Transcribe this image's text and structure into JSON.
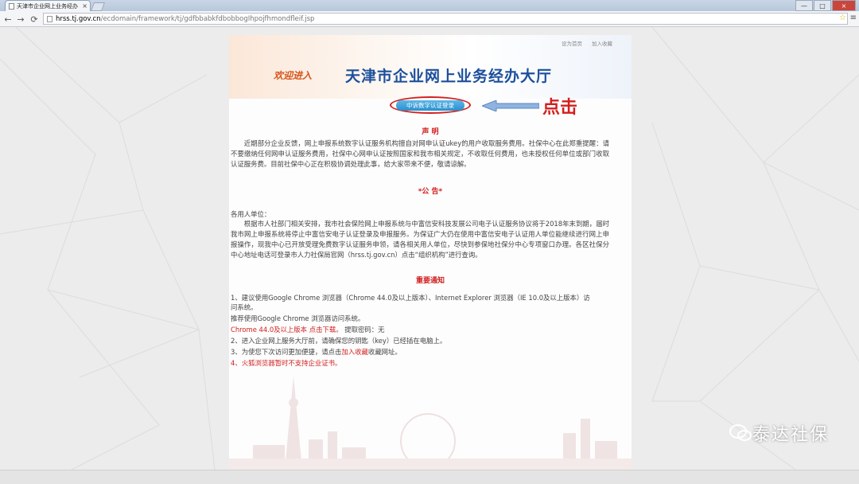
{
  "browser": {
    "tab_title": "天津市企业网上业务经办",
    "tab_close": "×",
    "url_host": "hrss.tj.gov.cn",
    "url_path": "/ecdomain/framework/tj/gdfbbabkfdbobbogIhpojfhmondfleif.jsp",
    "window_controls": [
      "—",
      "□",
      "×"
    ]
  },
  "page": {
    "top_links": [
      "设为首页",
      "加入收藏"
    ],
    "welcome": "欢迎进入",
    "title": "天津市企业网上业务经办大厅",
    "login_button": "中诉数字认证登录",
    "annotation_click": "点击",
    "statement_heading": "声  明",
    "statement_body": "近期部分企业反馈，网上申报系统数字认证服务机构擅自对网申认证ukey的用户收取服务费用。社保中心在此郑重提醒：请不要缴纳任何网申认证服务费用，社保中心网申认证按照国家和我市相关规定，不收取任何费用，也未授权任何单位或部门收取认证服务费。目前社保中心正在积极协调处理此事，给大家带来不便，敬请谅解。",
    "notice_heading": "*公  告*",
    "notice_salutation": "各用人单位：",
    "notice_body": "根据市人社部门相关安排，我市社会保险网上申报系统与中富信安科技发展公司电子认证服务协议将于2018年末到期，届时我市网上申报系统将停止中富信安电子认证登录及申报服务。为保证广大仍在使用中富信安电子认证用人单位能继续进行网上申报操作，现我中心已开放受理免费数字认证服务申领，请各相关用人单位，尽快到参保地社保分中心专项窗口办理。各区社保分中心地址电话可登录市人力社保局官网（hrss.tj.gov.cn）点击“组织机构”进行查询。",
    "important_heading": "重要通知",
    "item1_a": "1、建议使用Google Chrome 浏览器（Chrome 44.0及以上版本）、Internet Explorer 浏览器（IE 10.0及以上版本）访",
    "item1_b": "问系统。",
    "item1_c": "推荐使用Google Chrome 浏览器访问系统。",
    "download_link": "Chrome 44.0及以上版本 点击下载。",
    "extract_code": " 提取密码：无",
    "item2": "2、进入企业网上服务大厅前，请确保您的钥匙（key）已经插在电脑上。",
    "item3_pre": "3、为使您下次访问更加便捷，请点击",
    "item3_link": "加入收藏",
    "item3_post": "收藏网址。",
    "item4": "4、火狐浏览器暂时不支持企业证书。"
  },
  "watermark": "泰达社保",
  "colors": {
    "title_blue": "#1c4f9c",
    "red": "#d21f1f",
    "welcome_orange": "#d6561c"
  }
}
